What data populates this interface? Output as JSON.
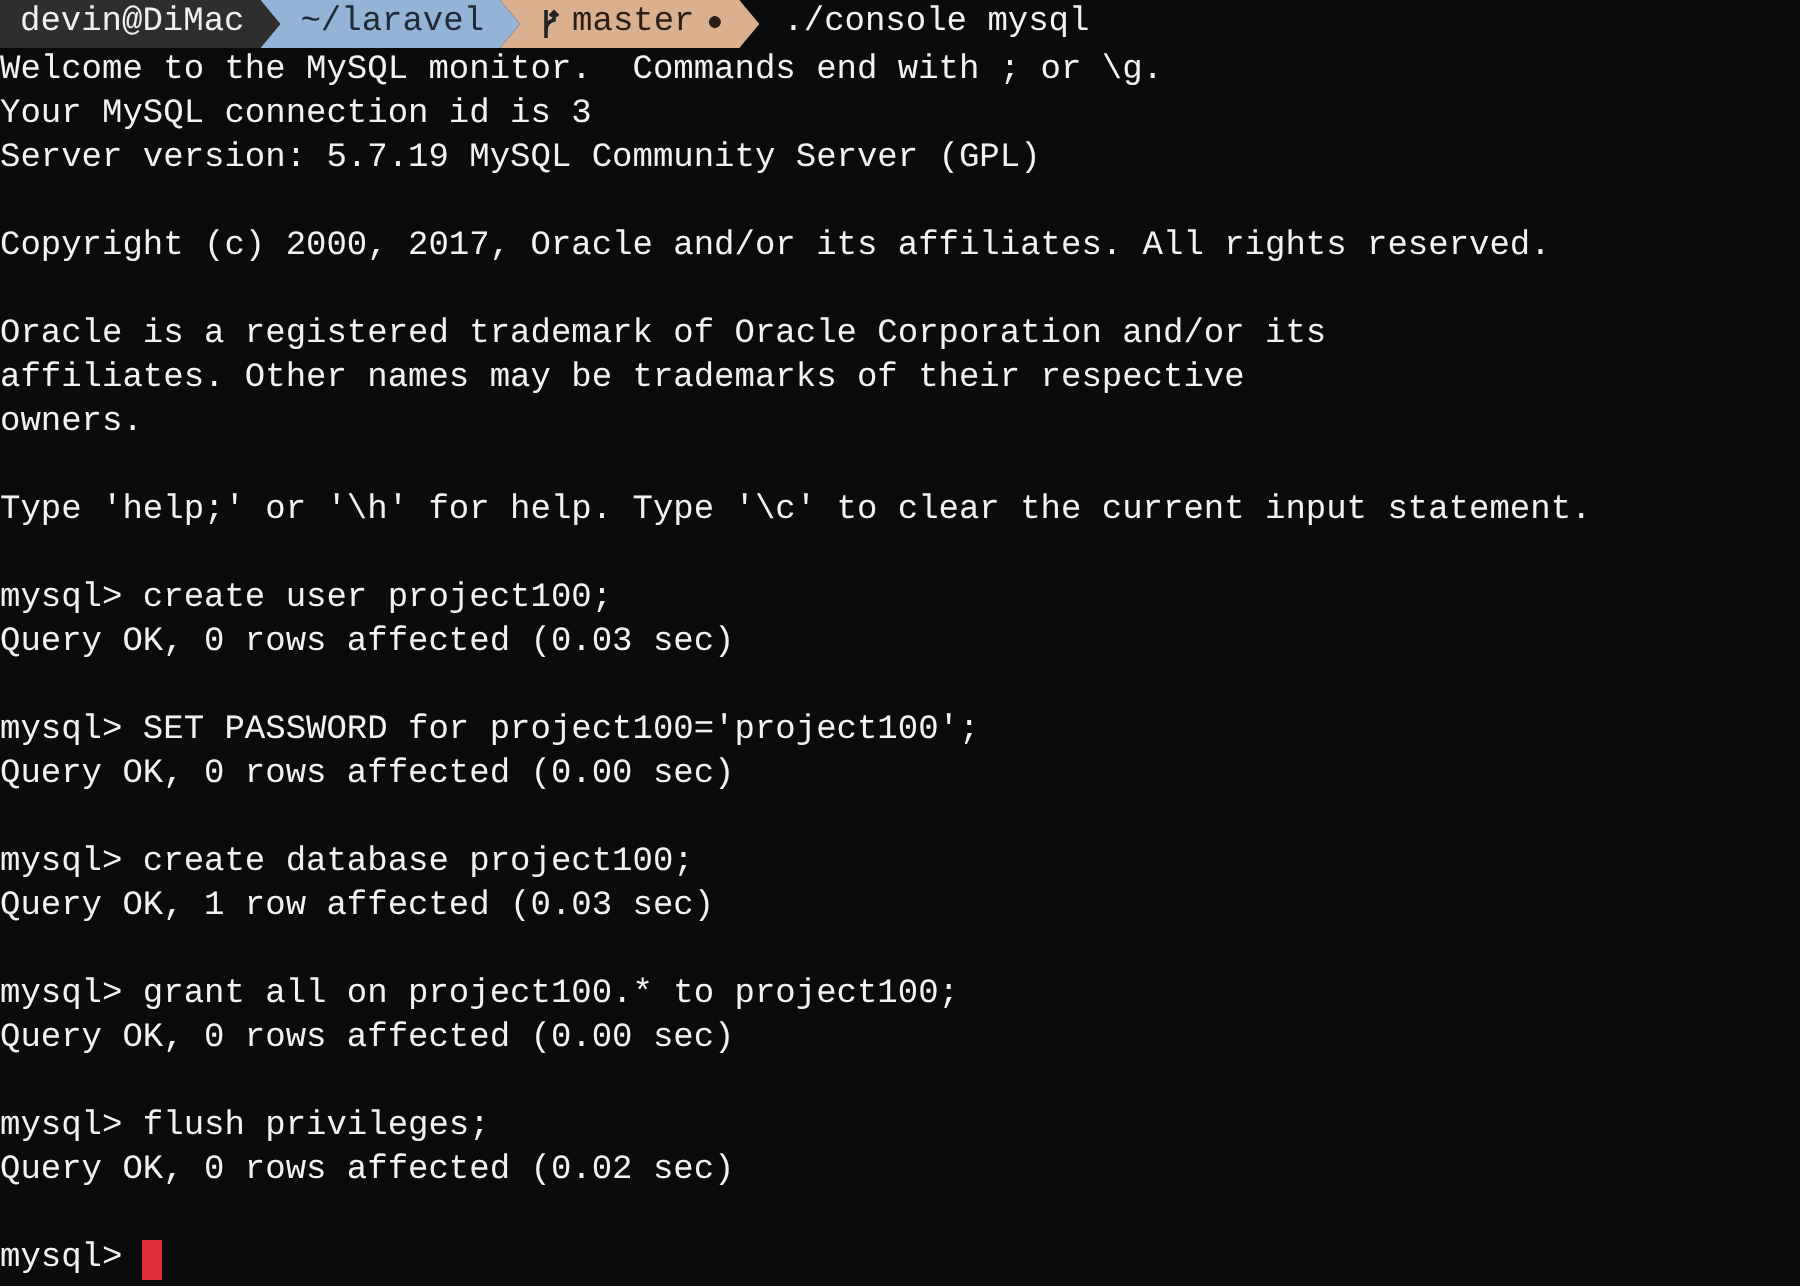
{
  "prompt": {
    "segments": [
      {
        "kind": "user",
        "text": "devin@DiMac"
      },
      {
        "kind": "dir",
        "text": "~/laravel"
      },
      {
        "kind": "git",
        "text": "master",
        "dirty": "●"
      }
    ],
    "command": "./console mysql"
  },
  "output_blocks": [
    [
      "Welcome to the MySQL monitor.  Commands end with ; or \\g.",
      "Your MySQL connection id is 3",
      "Server version: 5.7.19 MySQL Community Server (GPL)"
    ],
    [
      "Copyright (c) 2000, 2017, Oracle and/or its affiliates. All rights reserved."
    ],
    [
      "Oracle is a registered trademark of Oracle Corporation and/or its",
      "affiliates. Other names may be trademarks of their respective",
      "owners."
    ],
    [
      "Type 'help;' or '\\h' for help. Type '\\c' to clear the current input statement."
    ],
    [
      "mysql> create user project100;",
      "Query OK, 0 rows affected (0.03 sec)"
    ],
    [
      "mysql> SET PASSWORD for project100='project100';",
      "Query OK, 0 rows affected (0.00 sec)"
    ],
    [
      "mysql> create database project100;",
      "Query OK, 1 row affected (0.03 sec)"
    ],
    [
      "mysql> grant all on project100.* to project100;",
      "Query OK, 0 rows affected (0.00 sec)"
    ],
    [
      "mysql> flush privileges;",
      "Query OK, 0 rows affected (0.02 sec)"
    ]
  ],
  "current_prompt": "mysql>"
}
